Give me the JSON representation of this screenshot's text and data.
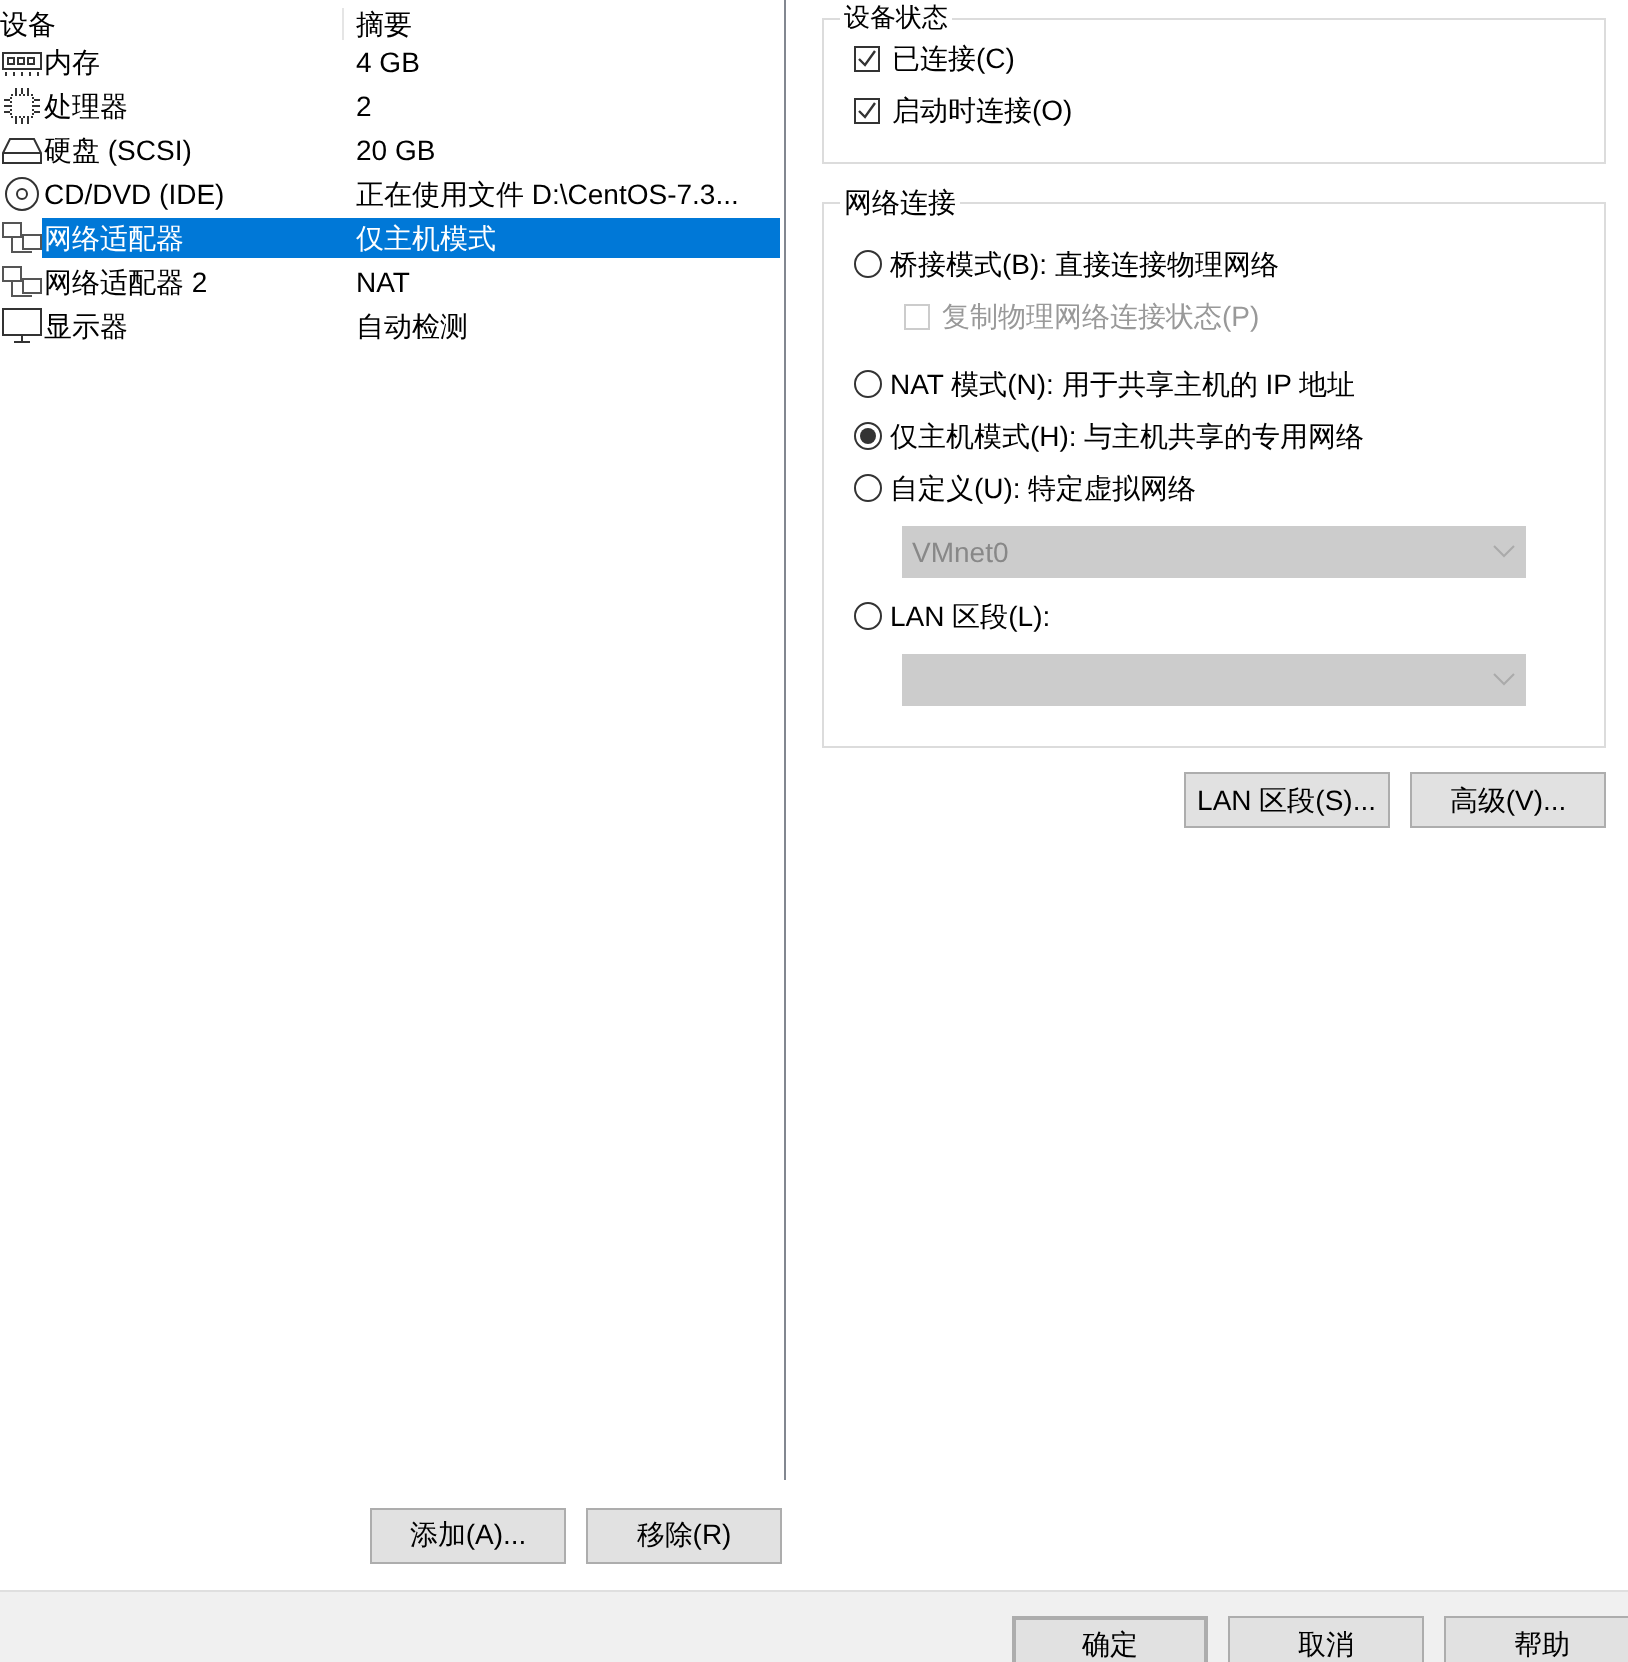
{
  "device_table": {
    "columns": [
      "设备",
      "摘要"
    ],
    "rows": [
      {
        "kind": "memory",
        "device": "内存",
        "summary": "4 GB",
        "selected": false
      },
      {
        "kind": "cpu",
        "device": "处理器",
        "summary": "2",
        "selected": false
      },
      {
        "kind": "disk",
        "device": "硬盘 (SCSI)",
        "summary": "20 GB",
        "selected": false
      },
      {
        "kind": "cd",
        "device": "CD/DVD (IDE)",
        "summary": "正在使用文件 D:\\CentOS-7.3...",
        "selected": false
      },
      {
        "kind": "network",
        "device": "网络适配器",
        "summary": "仅主机模式",
        "selected": true
      },
      {
        "kind": "network",
        "device": "网络适配器 2",
        "summary": "NAT",
        "selected": false
      },
      {
        "kind": "display",
        "device": "显示器",
        "summary": "自动检测",
        "selected": false
      }
    ]
  },
  "device_buttons": [
    "添加(A)...",
    "移除(R)"
  ],
  "device_status": {
    "title": "设备状态",
    "options": [
      {
        "label": "已连接(C)",
        "checked": true
      },
      {
        "label": "启动时连接(O)",
        "checked": true
      }
    ]
  },
  "network_connection": {
    "title": "网络连接",
    "items": [
      {
        "kind": "radio",
        "label": "桥接模式(B): 直接连接物理网络",
        "selected": false
      },
      {
        "kind": "checkbox",
        "label": "复制物理网络连接状态(P)",
        "checked": false,
        "disabled": true
      },
      {
        "kind": "radio",
        "label": "NAT 模式(N): 用于共享主机的 IP 地址",
        "selected": false
      },
      {
        "kind": "radio",
        "label": "仅主机模式(H): 与主机共享的专用网络",
        "selected": true
      },
      {
        "kind": "radio",
        "label": "自定义(U): 特定虚拟网络",
        "selected": false
      },
      {
        "kind": "select",
        "value": "VMnet0",
        "disabled": true
      },
      {
        "kind": "radio",
        "label": "LAN 区段(L):",
        "selected": false
      },
      {
        "kind": "select",
        "disabled": true
      }
    ]
  },
  "network_buttons": [
    "LAN 区段(S)...",
    "高级(V)..."
  ],
  "dialog_buttons": [
    {
      "label": "确定",
      "default": true
    },
    {
      "label": "取消",
      "default": false
    },
    {
      "label": "帮助",
      "default": false
    }
  ]
}
